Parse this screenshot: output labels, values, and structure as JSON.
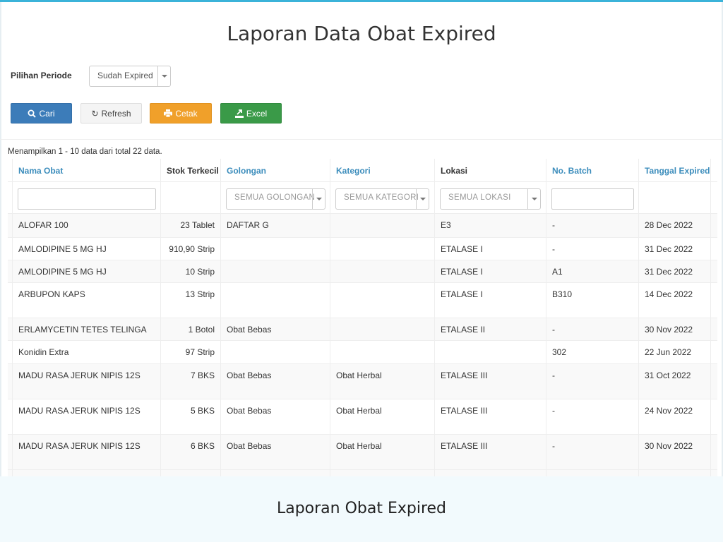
{
  "page": {
    "title": "Laporan Data Obat Expired"
  },
  "periode": {
    "label": "Pilihan Periode",
    "selected": "Sudah Expired"
  },
  "buttons": {
    "cari": "Cari",
    "refresh": "Refresh",
    "cetak": "Cetak",
    "excel": "Excel"
  },
  "info": "Menampilkan 1 - 10 data dari total 22 data.",
  "columns": [
    "Nama Obat",
    "Stok Terkecil",
    "Golongan",
    "Kategori",
    "Lokasi",
    "No. Batch",
    "Tanggal Expired"
  ],
  "filters": {
    "golongan": "SEMUA GOLONGAN",
    "kategori": "SEMUA KATEGORI",
    "lokasi": "SEMUA LOKASI"
  },
  "rows": [
    [
      "ALOFAR 100",
      "23 Tablet",
      "DAFTAR G",
      "",
      "E3",
      "-",
      "28 Dec 2022"
    ],
    [
      "AMLODIPINE 5 MG HJ",
      "910,90 Strip",
      "",
      "",
      "ETALASE I",
      "-",
      "31 Dec 2022"
    ],
    [
      "AMLODIPINE 5 MG HJ",
      "10 Strip",
      "",
      "",
      "ETALASE I",
      "A1",
      "31 Dec 2022"
    ],
    [
      "ARBUPON KAPS",
      "13 Strip",
      "",
      "",
      "ETALASE I",
      "B310",
      "14 Dec 2022"
    ],
    [
      "ERLAMYCETIN TETES TELINGA",
      "1 Botol",
      "Obat Bebas",
      "",
      "ETALASE II",
      "-",
      "30 Nov 2022"
    ],
    [
      "Konidin Extra",
      "97 Strip",
      "",
      "",
      "",
      "302",
      "22 Jun 2022"
    ],
    [
      "MADU RASA JERUK NIPIS 12S",
      "7 BKS",
      "Obat Bebas",
      "Obat Herbal",
      "ETALASE III",
      "-",
      "31 Oct 2022"
    ],
    [
      "MADU RASA JERUK NIPIS 12S",
      "5 BKS",
      "Obat Bebas",
      "Obat Herbal",
      "ETALASE III",
      "-",
      "24 Nov 2022"
    ],
    [
      "MADU RASA JERUK NIPIS 12S",
      "6 BKS",
      "Obat Bebas",
      "Obat Herbal",
      "ETALASE III",
      "-",
      "30 Nov 2022"
    ]
  ],
  "caption": "Laporan Obat Expired"
}
